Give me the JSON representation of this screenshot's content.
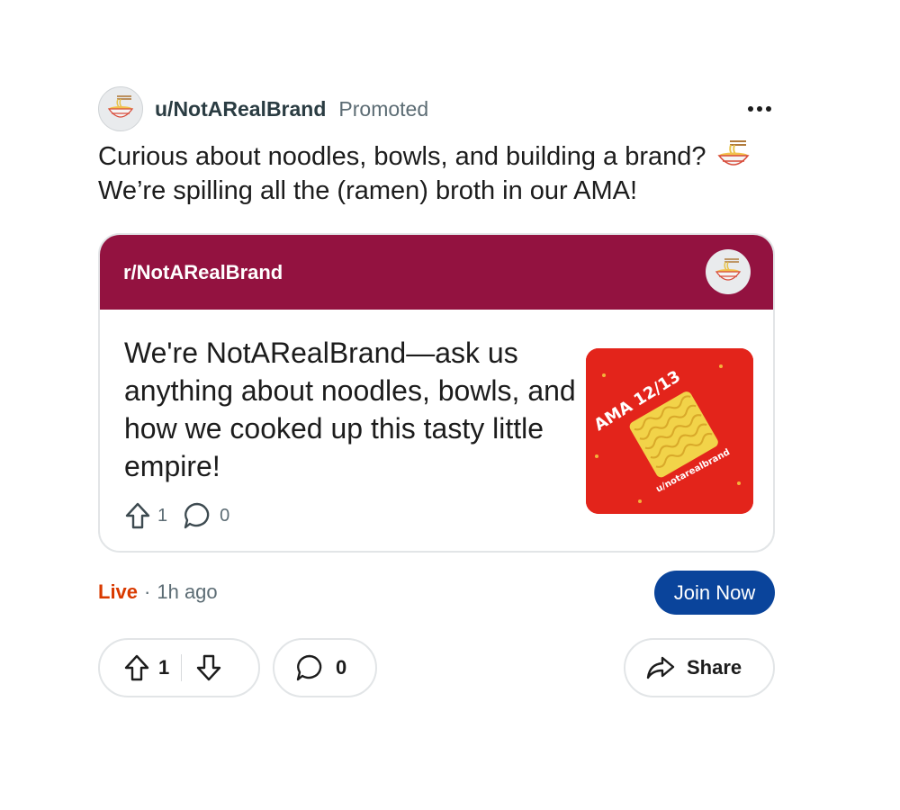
{
  "post": {
    "username": "u/NotARealBrand",
    "promoted_label": "Promoted",
    "title_part1": "Curious about noodles, bowls, and building a brand?",
    "title_part2": "We’re spilling all the (ramen) broth in our AMA!"
  },
  "card": {
    "subreddit": "r/NotARealBrand",
    "title": "We're NotARealBrand—ask us anything about noodles, bowls, and how we cooked up this tasty little empire!",
    "upvotes": "1",
    "comments": "0",
    "thumbnail_text_1": "AMA 12/13",
    "thumbnail_text_2": "u/notarealbrand",
    "header_color": "#931240"
  },
  "status": {
    "live_label": "Live",
    "separator": "·",
    "time_ago": "1h ago",
    "join_label": "Join Now"
  },
  "actions": {
    "vote_count": "1",
    "comment_count": "0",
    "share_label": "Share"
  },
  "icons": [
    "ramen-bowl-icon",
    "more-options-icon",
    "upvote-icon",
    "downvote-icon",
    "comment-icon",
    "share-icon"
  ],
  "colors": {
    "accent_blue": "#0a449b",
    "live_orange": "#d93a00",
    "card_header": "#931240"
  }
}
